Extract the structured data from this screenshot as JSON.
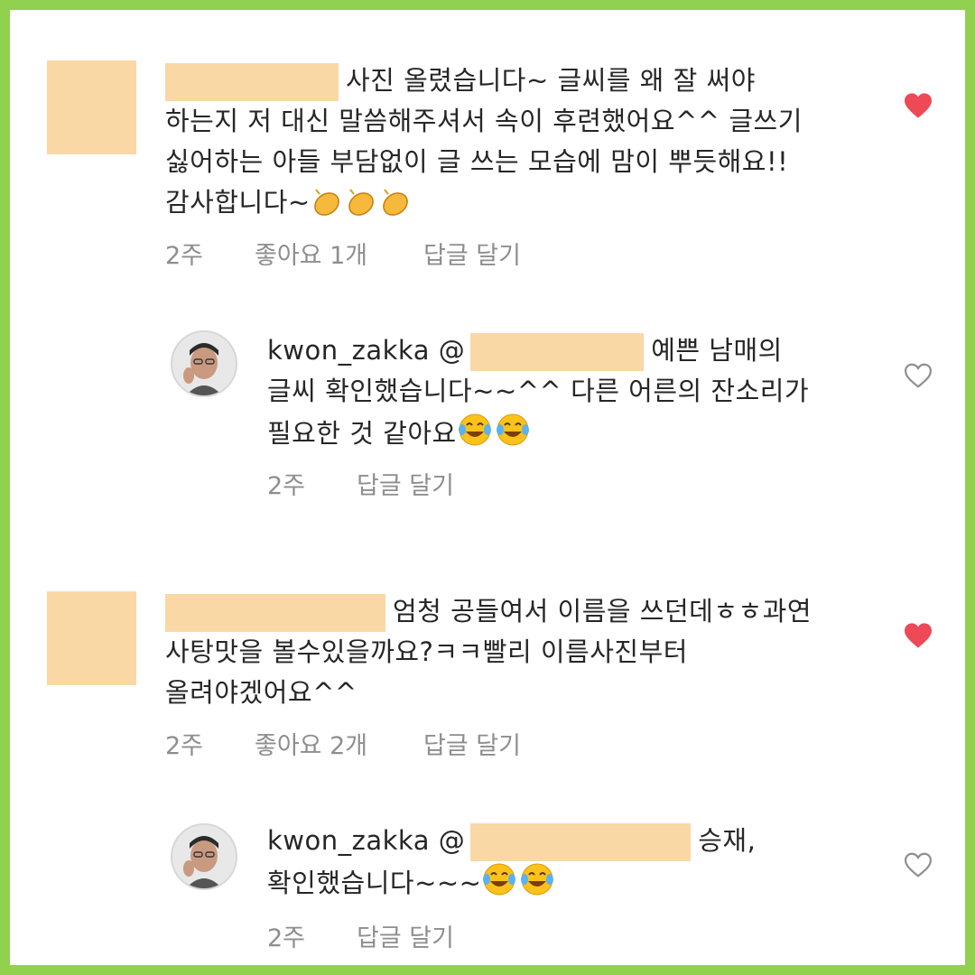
{
  "comments": [
    {
      "line1_suffix": "사진 올렸습니다~ 글씨를 왜 잘 써야",
      "line2": "하는지 저 대신 말씀해주셔서 속이 후련했어요^^ 글쓰기",
      "line3": "싫어하는 아들 부담없이 글 쓰는 모습에 맘이 뿌듯해요!!",
      "line4": "감사합니다~",
      "emoji": "clapping-hands",
      "meta": {
        "time": "2주",
        "likes": "좋아요 1개",
        "reply": "답글 달기"
      },
      "liked": true,
      "heart_color": "#ed4956"
    },
    {
      "username": "kwon_zakka",
      "mention_prefix": "@",
      "line1_suffix": "예쁜 남매의",
      "line2": "글씨 확인했습니다~~^^ 다른 어른의 잔소리가",
      "line3": "필요한 것 같아요",
      "emoji": "tears-of-joy",
      "meta": {
        "time": "2주",
        "reply": "답글 달기"
      },
      "liked": false
    },
    {
      "line1_suffix": "엄청 공들여서 이름을 쓰던데ㅎㅎ과연",
      "line2": "사탕맛을 볼수있을까요?ㅋㅋ빨리 이름사진부터",
      "line3": "올려야겠어요^^",
      "meta": {
        "time": "2주",
        "likes": "좋아요 2개",
        "reply": "답글 달기"
      },
      "liked": true,
      "heart_color": "#ed4956"
    },
    {
      "username": "kwon_zakka",
      "mention_prefix": "@",
      "line1_suffix": "승재,",
      "line2": "확인했습니다~~~",
      "emoji": "tears-of-joy",
      "meta": {
        "time": "2주",
        "reply": "답글 달기"
      },
      "liked": false
    }
  ],
  "colors": {
    "frame": "#92d050",
    "redaction": "#f9d8a5",
    "text": "#262626",
    "meta": "#8e8e8e"
  }
}
